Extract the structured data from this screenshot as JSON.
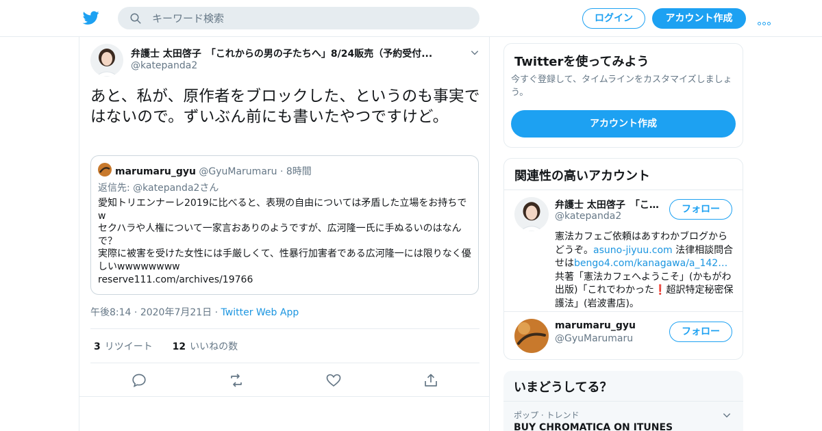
{
  "topbar": {
    "search_placeholder": "キーワード検索",
    "login_label": "ログイン",
    "signup_label": "アカウント作成",
    "brand_color": "#1da1f2"
  },
  "tweet": {
    "author_name": "弁護士 太田啓子　「これからの男の子たちへ」8/24販売（予約受付...",
    "author_handle": "@katepanda2",
    "text": "あと、私が、原作者をブロックした、というのも事実ではないので。ずいぶん前にも書いたやつですけど。",
    "quote": {
      "name": "marumaru_gyu",
      "handle": "@GyuMarumaru",
      "separator": "·",
      "time": "8時間",
      "reply_prefix": "返信先:",
      "reply_to": "@katepanda2さん",
      "lines": [
        "愛知トリエンナーレ2019に比べると、表現の自由については矛盾した立場をお持ちでw",
        "セクハラや人権について一家言おありのようですが、広河隆一氏に手ぬるいのはなんで？",
        "実際に被害を受けた女性には手厳しくて、性暴行加害者である広河隆一には限りなく優しいwwwwwwww",
        "reserve111.com/archives/19766"
      ]
    },
    "time": "午後8:14",
    "separator": "·",
    "date": "2020年7月21日",
    "app": "Twitter Web App",
    "retweet_count": "3",
    "retweet_label": "リツイート",
    "like_count": "12",
    "like_label": "いいねの数"
  },
  "sidebar": {
    "try_card": {
      "title": "Twitterを使ってみよう",
      "subtitle": "今すぐ登録して、タイムラインをカスタマイズしましょう。",
      "button": "アカウント作成"
    },
    "related": {
      "title": "関連性の高いアカウント",
      "follow_label": "フォロー",
      "accounts": [
        {
          "name": "弁護士 太田啓子　「これからの男の子たちへ」",
          "handle": "@katepanda2",
          "bio_1": "憲法カフェご依頼はあすわかブログからどうぞ。",
          "bio_link1": "asuno-jiyuu.com",
          "bio_2": " 法律相談問合せは",
          "bio_link2": "bengo4.com/kanagawa/a_142…",
          "bio_3": " 共著「憲法カフェへようこそ」(かもがわ出版)「これでわかった",
          "bio_emoji": "❗",
          "bio_4": "超訳特定秘密保護法」(岩波書店)。"
        },
        {
          "name": "marumaru_gyu",
          "handle": "@GyuMarumaru"
        }
      ]
    },
    "trends": {
      "title": "いまどうしてる？",
      "category": "ポップ · トレンド",
      "name": "BUY CHROMATICA ON ITUNES"
    }
  }
}
